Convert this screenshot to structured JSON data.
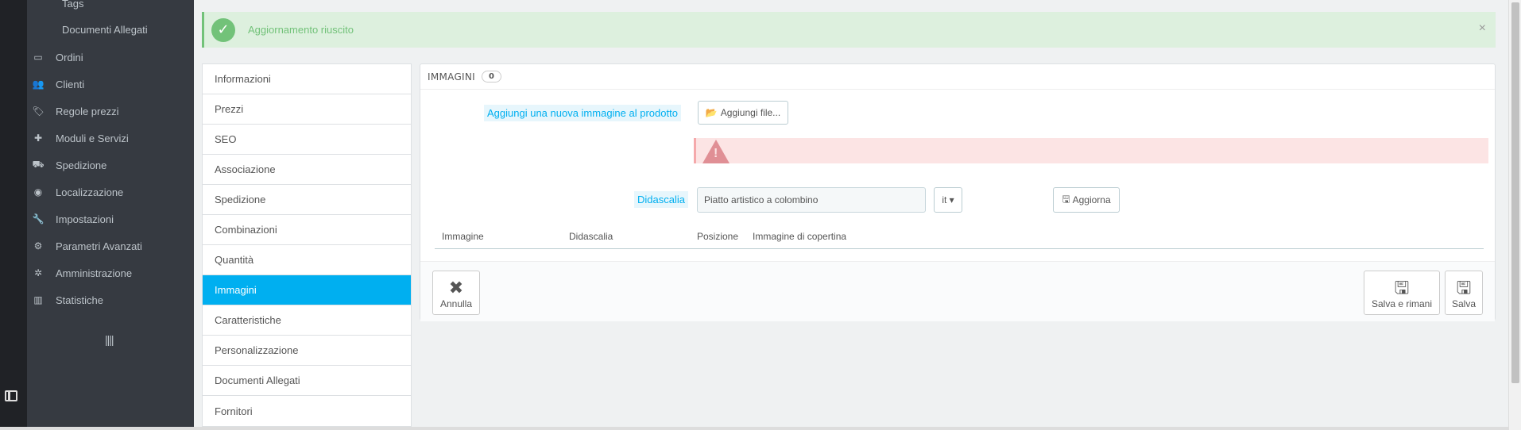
{
  "sidebar": {
    "sub_items": [
      "Tags",
      "Documenti Allegati"
    ],
    "items": [
      {
        "label": "Ordini",
        "icon": "credit-card-icon",
        "glyph": "▭"
      },
      {
        "label": "Clienti",
        "icon": "users-icon",
        "glyph": "👥"
      },
      {
        "label": "Regole prezzi",
        "icon": "tags-icon",
        "glyph": "🏷"
      },
      {
        "label": "Moduli e Servizi",
        "icon": "puzzle-icon",
        "glyph": "✚"
      },
      {
        "label": "Spedizione",
        "icon": "truck-icon",
        "glyph": "⛟"
      },
      {
        "label": "Localizzazione",
        "icon": "globe-icon",
        "glyph": "◉"
      },
      {
        "label": "Impostazioni",
        "icon": "wrench-icon",
        "glyph": "🔧"
      },
      {
        "label": "Parametri Avanzati",
        "icon": "cogs-icon",
        "glyph": "⚙"
      },
      {
        "label": "Amministrazione",
        "icon": "cog-icon",
        "glyph": "✲"
      },
      {
        "label": "Statistiche",
        "icon": "bar-chart-icon",
        "glyph": "▥"
      }
    ],
    "collapse_glyph": "||||"
  },
  "alert": {
    "message": "Aggiornamento riuscito",
    "close": "×",
    "color": "#72c279"
  },
  "tabs": [
    "Informazioni",
    "Prezzi",
    "SEO",
    "Associazione",
    "Spedizione",
    "Combinazioni",
    "Quantità",
    "Immagini",
    "Caratteristiche",
    "Personalizzazione",
    "Documenti Allegati",
    "Fornitori"
  ],
  "active_tab_index": 7,
  "panel": {
    "title": "Immagini",
    "count": "0",
    "add_image_label": "Aggiungi una nuova immagine al prodotto",
    "add_file_button": "Aggiungi file...",
    "caption_label": "Didascalia",
    "caption_value": "Piatto artistico a colombino",
    "lang_button": "it ▾",
    "update_button": "Aggiorna",
    "table_headers": [
      "Immagine",
      "Didascalia",
      "Posizione",
      "Immagine di copertina"
    ],
    "cancel_button": "Annulla",
    "save_stay_button": "Salva e rimani",
    "save_button": "Salva"
  },
  "colors": {
    "accent": "#00aff0",
    "sidebar_bg": "#363a41",
    "success": "#72c279",
    "error_bg": "#fce4e4"
  }
}
